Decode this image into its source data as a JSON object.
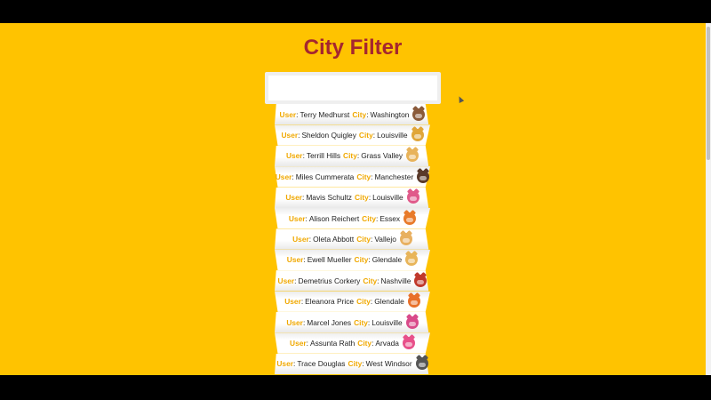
{
  "page": {
    "title": "City Filter",
    "background_color": "#ffc300",
    "title_color": "#a5262f",
    "label_color": "#f0a800"
  },
  "filter": {
    "value": "",
    "placeholder": ""
  },
  "labels": {
    "user": "User",
    "city": "City",
    "colon": ":"
  },
  "users": [
    {
      "user": "Terry Medhurst",
      "city": "Washington",
      "avatar_icon": "cat-avatar-icon",
      "avatar_color": "#8a5a3a"
    },
    {
      "user": "Sheldon Quigley",
      "city": "Louisville",
      "avatar_icon": "cat-avatar-icon",
      "avatar_color": "#e0a63a"
    },
    {
      "user": "Terrill Hills",
      "city": "Grass Valley",
      "avatar_icon": "cat-avatar-icon",
      "avatar_color": "#e8b35a"
    },
    {
      "user": "Miles Cummerata",
      "city": "Manchester",
      "avatar_icon": "cat-avatar-icon",
      "avatar_color": "#5a3a2a"
    },
    {
      "user": "Mavis Schultz",
      "city": "Louisville",
      "avatar_icon": "cat-avatar-icon",
      "avatar_color": "#e05a8a"
    },
    {
      "user": "Alison Reichert",
      "city": "Essex",
      "avatar_icon": "cat-avatar-icon",
      "avatar_color": "#e87a2a"
    },
    {
      "user": "Oleta Abbott",
      "city": "Vallejo",
      "avatar_icon": "cat-avatar-icon",
      "avatar_color": "#e8b060"
    },
    {
      "user": "Ewell Mueller",
      "city": "Glendale",
      "avatar_icon": "cat-avatar-icon",
      "avatar_color": "#e8b55a"
    },
    {
      "user": "Demetrius Corkery",
      "city": "Nashville",
      "avatar_icon": "cat-avatar-icon",
      "avatar_color": "#c0392b"
    },
    {
      "user": "Eleanora Price",
      "city": "Glendale",
      "avatar_icon": "cat-avatar-icon",
      "avatar_color": "#e8702a"
    },
    {
      "user": "Marcel Jones",
      "city": "Louisville",
      "avatar_icon": "cat-avatar-icon",
      "avatar_color": "#d94a8a"
    },
    {
      "user": "Assunta Rath",
      "city": "Arvada",
      "avatar_icon": "cat-avatar-icon",
      "avatar_color": "#e8508a"
    },
    {
      "user": "Trace Douglas",
      "city": "West Windsor",
      "avatar_icon": "cat-avatar-icon",
      "avatar_color": "#555555"
    }
  ]
}
